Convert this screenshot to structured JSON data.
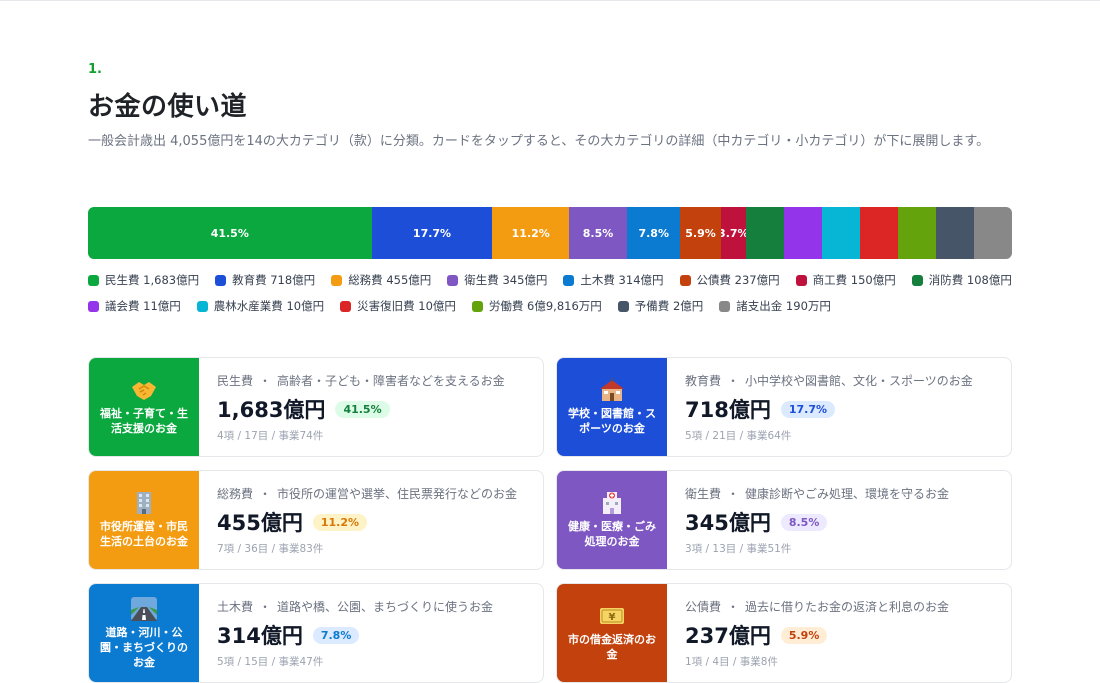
{
  "section": {
    "number": "1.",
    "title": "お金の使い道",
    "description": "一般会計歳出 4,055億円を14の大カテゴリ（款）に分類。カードをタップすると、その大カテゴリの詳細（中カテゴリ・小カテゴリ）が下に展開します。"
  },
  "colors": {
    "minsei": "#0aa83f",
    "kyoiku": "#1d4ed8",
    "somu": "#f39c12",
    "eisei": "#7e57c2",
    "doboku": "#0b7ad1",
    "kosai": "#c2410c",
    "shoko": "#be123c",
    "shobo": "#15803d",
    "gikai": "#9333ea",
    "norin": "#06b6d4",
    "saigai": "#dc2626",
    "rodo": "#65a30d",
    "yobi": "#475569",
    "shoshishutsu": "#888888"
  },
  "chart_data": {
    "type": "bar",
    "categories": [
      "民生費",
      "教育費",
      "総務費",
      "衛生費",
      "土木費",
      "公債費",
      "商工費",
      "消防費",
      "議会費",
      "農林水産業費",
      "災害復旧費",
      "労働費",
      "予備費",
      "諸支出金"
    ],
    "shares_percent": [
      41.5,
      17.7,
      11.2,
      8.5,
      7.8,
      5.9,
      3.7,
      2.7,
      0.3,
      0.2,
      0.2,
      0.2,
      0.05,
      0.0
    ],
    "segments": [
      {
        "key": "minsei",
        "label": "41.5%",
        "pct": 41.5
      },
      {
        "key": "kyoiku",
        "label": "17.7%",
        "pct": 17.7
      },
      {
        "key": "somu",
        "label": "11.2%",
        "pct": 11.2
      },
      {
        "key": "eisei",
        "label": "8.5%",
        "pct": 8.5
      },
      {
        "key": "doboku",
        "label": "7.8%",
        "pct": 7.8
      },
      {
        "key": "kosai",
        "label": "5.9%",
        "pct": 5.9
      },
      {
        "key": "shoko",
        "label": "3.7%",
        "pct": 3.7
      },
      {
        "key": "shobo",
        "label": "",
        "pct": 2.7
      },
      {
        "key": "gikai",
        "label": "",
        "pct": 0.3
      },
      {
        "key": "norin",
        "label": "",
        "pct": 0.2
      },
      {
        "key": "saigai",
        "label": "",
        "pct": 0.2
      },
      {
        "key": "rodo",
        "label": "",
        "pct": 0.2
      },
      {
        "key": "yobi",
        "label": "",
        "pct": 0.05
      },
      {
        "key": "shoshishutsu",
        "label": "",
        "pct": 0.0
      }
    ]
  },
  "legend": [
    {
      "key": "minsei",
      "text": "民生費 1,683億円"
    },
    {
      "key": "kyoiku",
      "text": "教育費 718億円"
    },
    {
      "key": "somu",
      "text": "総務費 455億円"
    },
    {
      "key": "eisei",
      "text": "衛生費 345億円"
    },
    {
      "key": "doboku",
      "text": "土木費 314億円"
    },
    {
      "key": "kosai",
      "text": "公債費 237億円"
    },
    {
      "key": "shoko",
      "text": "商工費 150億円"
    },
    {
      "key": "shobo",
      "text": "消防費 108億円"
    },
    {
      "key": "gikai",
      "text": "議会費 11億円"
    },
    {
      "key": "norin",
      "text": "農林水産業費 10億円"
    },
    {
      "key": "saigai",
      "text": "災害復旧費 10億円"
    },
    {
      "key": "rodo",
      "text": "労働費 6億9,816万円"
    },
    {
      "key": "yobi",
      "text": "予備費 2億円"
    },
    {
      "key": "shoshishutsu",
      "text": "諸支出金 190万円"
    }
  ],
  "cards": [
    {
      "key": "minsei",
      "icon": "handshake-icon",
      "thumb": "福祉・子育て・生活支援のお金",
      "category": "民生費",
      "separator": "・",
      "desc": "高齢者・子ども・障害者などを支えるお金",
      "amount": "1,683億円",
      "pct": "41.5%",
      "pill_bg": "#dcfce7",
      "pill_fg": "#15803d",
      "counts": "4項 / 17目 / 事業74件"
    },
    {
      "key": "kyoiku",
      "icon": "school-icon",
      "thumb": "学校・図書館・スポーツのお金",
      "category": "教育費",
      "separator": "・",
      "desc": "小中学校や図書館、文化・スポーツのお金",
      "amount": "718億円",
      "pct": "17.7%",
      "pill_bg": "#dbeafe",
      "pill_fg": "#1d4ed8",
      "counts": "5項 / 21目 / 事業64件"
    },
    {
      "key": "somu",
      "icon": "office-building-icon",
      "thumb": "市役所運営・市民生活の土台のお金",
      "category": "総務費",
      "separator": "・",
      "desc": "市役所の運営や選挙、住民票発行などのお金",
      "amount": "455億円",
      "pct": "11.2%",
      "pill_bg": "#fef3c7",
      "pill_fg": "#d97706",
      "counts": "7項 / 36目 / 事業83件"
    },
    {
      "key": "eisei",
      "icon": "hospital-icon",
      "thumb": "健康・医療・ごみ処理のお金",
      "category": "衛生費",
      "separator": "・",
      "desc": "健康診断やごみ処理、環境を守るお金",
      "amount": "345億円",
      "pct": "8.5%",
      "pill_bg": "#ede9fe",
      "pill_fg": "#7e57c2",
      "counts": "3項 / 13目 / 事業51件"
    },
    {
      "key": "doboku",
      "icon": "road-icon",
      "thumb": "道路・河川・公園・まちづくりのお金",
      "category": "土木費",
      "separator": "・",
      "desc": "道路や橋、公園、まちづくりに使うお金",
      "amount": "314億円",
      "pct": "7.8%",
      "pill_bg": "#dbeafe",
      "pill_fg": "#0b7ad1",
      "counts": "5項 / 15目 / 事業47件"
    },
    {
      "key": "kosai",
      "icon": "yen-note-icon",
      "thumb": "市の借金返済のお金",
      "category": "公債費",
      "separator": "・",
      "desc": "過去に借りたお金の返済と利息のお金",
      "amount": "237億円",
      "pct": "5.9%",
      "pill_bg": "#ffedd5",
      "pill_fg": "#c2410c",
      "counts": "1項 / 4目 / 事業8件"
    }
  ]
}
